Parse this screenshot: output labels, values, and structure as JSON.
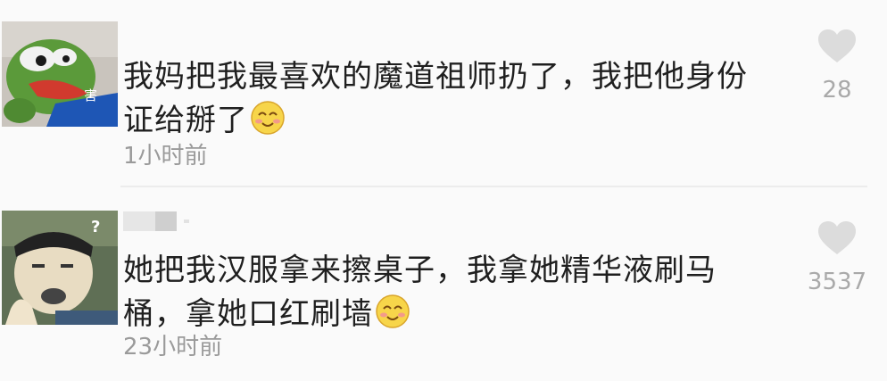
{
  "comments": [
    {
      "avatar_icon": "pepe-frog-avatar",
      "avatar_badge": "害",
      "text": "我妈把我最喜欢的魔道祖师扔了，我把他身份证给掰了",
      "emoji": "smiling-face-emoji",
      "time": "1小时前",
      "like_icon": "heart-icon",
      "likes": "28"
    },
    {
      "avatar_icon": "meme-face-avatar",
      "avatar_badge": "?",
      "username_hidden": true,
      "text": "她把我汉服拿来擦桌子，我拿她精华液刷马桶，拿她口红刷墙",
      "emoji": "smiling-face-emoji",
      "time": "23小时前",
      "like_icon": "heart-icon",
      "likes": "3537"
    }
  ],
  "colors": {
    "text": "#1f1f1f",
    "meta": "#9a9a9a",
    "heart": "#dcdcdc",
    "background": "#fafafa"
  }
}
